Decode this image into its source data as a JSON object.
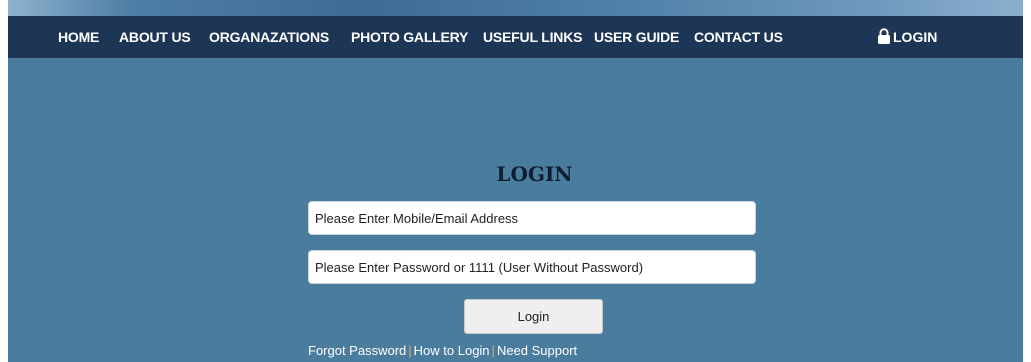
{
  "nav": {
    "items": [
      {
        "label": "HOME"
      },
      {
        "label": "ABOUT US"
      },
      {
        "label": "ORGANAZATIONS"
      },
      {
        "label": "PHOTO GALLERY"
      },
      {
        "label": "USEFUL LINKS"
      },
      {
        "label": "USER GUIDE"
      },
      {
        "label": "CONTACT US"
      }
    ],
    "login_label": "LOGIN"
  },
  "form": {
    "title": "LOGIN",
    "email_placeholder": "Please Enter Mobile/Email Address",
    "password_placeholder": "Please Enter Password or 1111 (User Without Password)",
    "submit_label": "Login"
  },
  "links": {
    "forgot": "Forgot Password",
    "how_to": "How to Login",
    "support": "Need Support",
    "separator": "|"
  },
  "colors": {
    "page_background": "#4a7c9e",
    "navbar": "#1e3656",
    "separator": "#e6a64b"
  },
  "icons": {
    "nav_login": "lock-icon"
  }
}
